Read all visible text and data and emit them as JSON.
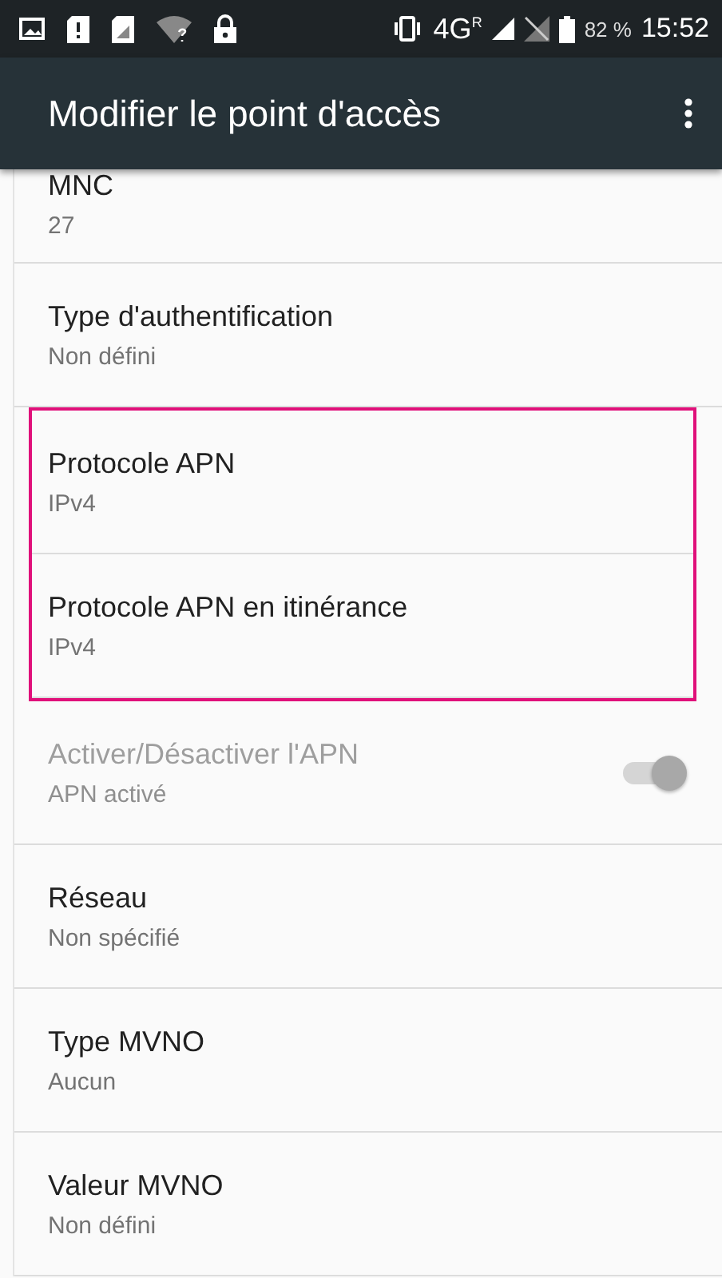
{
  "status_bar": {
    "network": "4G",
    "roaming": "R",
    "battery": "82 %",
    "time": "15:52"
  },
  "app_bar": {
    "title": "Modifier le point d'accès"
  },
  "items": [
    {
      "kind": "text",
      "title": "MNC",
      "summary": "27",
      "disabled": false,
      "highlighted": false
    },
    {
      "kind": "text",
      "title": "Type d'authentification",
      "summary": "Non défini",
      "disabled": false,
      "highlighted": false
    },
    {
      "kind": "text",
      "title": "Protocole APN",
      "summary": "IPv4",
      "disabled": false,
      "highlighted": true
    },
    {
      "kind": "text",
      "title": "Protocole APN en itinérance",
      "summary": "IPv4",
      "disabled": false,
      "highlighted": true
    },
    {
      "kind": "switch",
      "title": "Activer/Désactiver l'APN",
      "summary": "APN activé",
      "disabled": true,
      "highlighted": false,
      "on": true
    },
    {
      "kind": "text",
      "title": "Réseau",
      "summary": "Non spécifié",
      "disabled": false,
      "highlighted": false
    },
    {
      "kind": "text",
      "title": "Type MVNO",
      "summary": "Aucun",
      "disabled": false,
      "highlighted": false
    },
    {
      "kind": "text",
      "title": "Valeur MVNO",
      "summary": "Non défini",
      "disabled": false,
      "highlighted": false
    }
  ]
}
